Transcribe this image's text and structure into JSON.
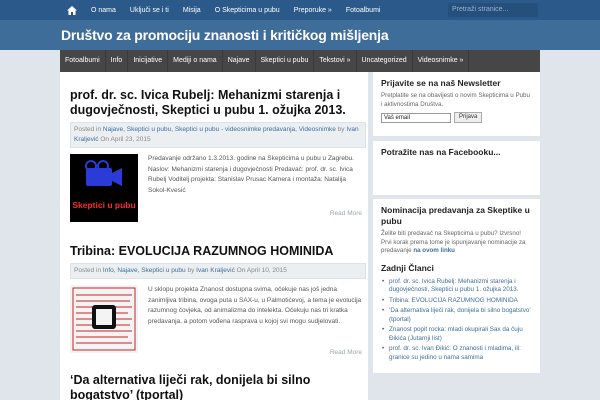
{
  "topbar": {
    "nav": [
      "O nama",
      "Uključi se i ti",
      "Misija",
      "O Skepticima u pubu",
      "Preporuke »",
      "Fotoalbumi"
    ],
    "search_placeholder": "Pretraži stranice..."
  },
  "site_title": "Društvo za promociju znanosti i kritičkog mišljenja",
  "menu": [
    "Fotoalbumi",
    "Info",
    "Inicijative",
    "Mediji o nama",
    "Najave",
    "Skeptici u pubu",
    "Tekstovi »",
    "Uncategorized",
    "Videosnimke »"
  ],
  "posts": [
    {
      "title": "prof. dr. sc. Ivica Rubelj: Mehanizmi starenja i dugovječnosti, Skeptici u pubu 1. ožujka 2013.",
      "meta_prefix": "Posted in",
      "categories": "Najave, Skeptici u pubu, Skeptici u pubu - videosnimke predavanja, Videosnimke",
      "meta_by": "by",
      "author": "Ivan Kraljević",
      "meta_on": "On",
      "date": "April 23, 2015",
      "excerpt": "Predavanje održano 1.3.2013. godine na Skepticima u pubu u Zagrebu. Naslov: Mehanizmi starenja i dugovječnosti Predavač: prof. dr. sc. Ivica Rubelj Voditelj projekta: Stanislav Prusac Kamera i montaža: Natalija Sokol-Kvesić",
      "thumb_text": "Skeptici u pubu",
      "readmore": "Read More"
    },
    {
      "title": "Tribina: EVOLUCIJA RAZUMNOG HOMINIDA",
      "meta_prefix": "Posted in",
      "categories": "Info, Najave, Skeptici u pubu",
      "meta_by": "by",
      "author": "Ivan Kraljević",
      "meta_on": "On",
      "date": "April 10, 2015",
      "excerpt": "U sklopu projekta Znanost dostupna svima, očekuje nas još jedna zanimljiva tribina, ovoga puta u SAX-u, u Palmotićevoj, a tema je evolucija razumnog čovjeka, od animalizma do intelekta. Očekuju nas tri kratka predavanja, a potom vođena rasprava u kojoj svi mogu sudjelovati.",
      "readmore": "Read More"
    },
    {
      "title": "‘Da alternativa liječi rak, donijela bi silno bogatstvo’ (tportal)"
    }
  ],
  "sidebar": {
    "newsletter_title": "Prijavite se na naš Newsletter",
    "newsletter_text": "Pretplatite se na obavijesti o novim Skepticima u Pubu i aktivnostima Društva.",
    "newsletter_input": "Vaš email",
    "newsletter_button": "Prijava",
    "facebook_title": "Potražite nas na Facebooku...",
    "nominate_title": "Nominacija predavanja za Skeptike u pubu",
    "nominate_text": "Želite biti predavač na Skepticima u pubu? Izvrsno! Prvi korak prema tome je ispunjavanje nominacije za predavanje",
    "nominate_link": "na ovom linku",
    "latest_title": "Zadnji Članci",
    "latest": [
      "prof. dr. sc. Ivica Rubelj: Mehanizmi starenja i dugovječnosti, Skeptici u pubu 1. ožujka 2013.",
      "Tribina: EVOLUCIJA RAZUMNOG HOMINIDA",
      "‘Da alternativa liječi rak, donijela bi silno bogatstvo’ (tportal)",
      "Znanost popit rocka: mladi okupirali Sax da čuju Đikića (Jutarnji list)",
      "prof. dr. sc. Ivan Đikić: O znanosti i mladima, ili: granice su jedino u nama samima"
    ]
  }
}
